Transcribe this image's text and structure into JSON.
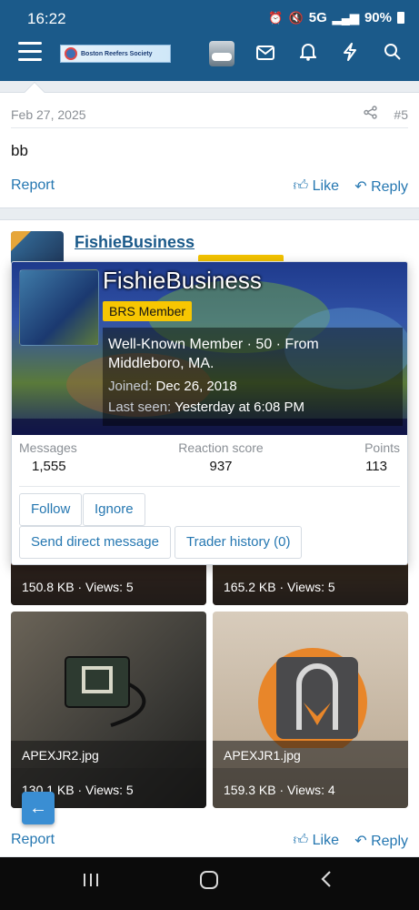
{
  "status_bar": {
    "time": "16:22",
    "network": "5G",
    "battery": "90%"
  },
  "header": {
    "logo_text": "Boston Reefers Society",
    "icons": [
      "menu-icon",
      "mail-icon",
      "bell-icon",
      "bolt-icon",
      "search-icon"
    ]
  },
  "post": {
    "date": "Feb 27, 2025",
    "number": "#5",
    "body": "bb",
    "report_label": "Report",
    "like_label": "Like",
    "reply_label": "Reply"
  },
  "post2": {
    "username": "FishieBusiness"
  },
  "member_card": {
    "name": "FishieBusiness",
    "badge": "BRS Member",
    "title_line": "Well-Known Member · 50 · From Middleboro, MA.",
    "joined_label": "Joined:",
    "joined_value": "Dec 26, 2018",
    "last_seen_label": "Last seen:",
    "last_seen_value": "Yesterday at 6:08 PM",
    "stats": [
      {
        "label": "Messages",
        "value": "1,555"
      },
      {
        "label": "Reaction score",
        "value": "937"
      },
      {
        "label": "Points",
        "value": "113"
      }
    ],
    "buttons": {
      "follow": "Follow",
      "ignore": "Ignore",
      "message": "Send direct message",
      "trader": "Trader history (0)"
    }
  },
  "attachments": [
    {
      "name": "",
      "meta": "150.8 KB · Views: 5"
    },
    {
      "name": "",
      "meta": "165.2 KB · Views: 5"
    },
    {
      "name": "APEXJR2.jpg",
      "meta": "130.1 KB · Views: 5"
    },
    {
      "name": "APEXJR1.jpg",
      "meta": "159.3 KB · Views: 4"
    }
  ],
  "post2_actions": {
    "report_label": "Report",
    "like_label": "Like",
    "reply_label": "Reply"
  }
}
